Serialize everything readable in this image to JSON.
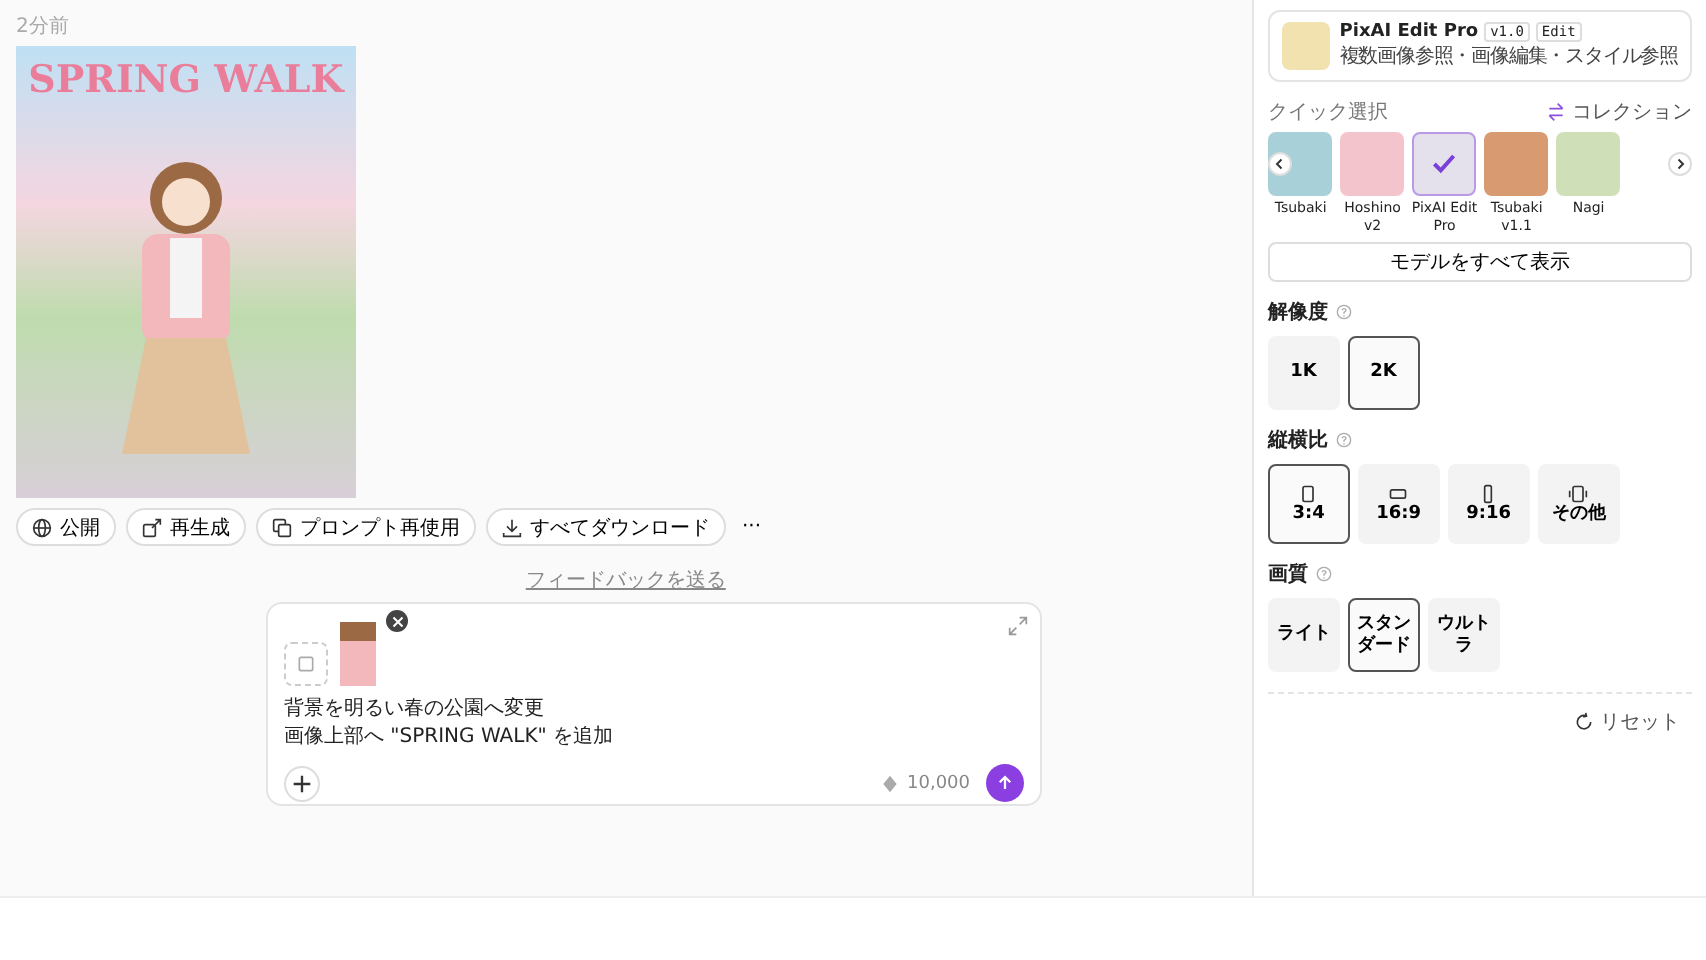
{
  "generation": {
    "time": "2分前",
    "image_title": "SPRING WALK",
    "actions": [
      {
        "kind": "globe",
        "label": "公開"
      },
      {
        "kind": "regen",
        "label": "再生成"
      },
      {
        "kind": "copy",
        "label": "プロンプト再使用"
      },
      {
        "kind": "download",
        "label": "すべてダウンロード"
      },
      {
        "kind": "more",
        "label": "···"
      }
    ]
  },
  "feedback_link": "フィードバックを送る",
  "composer": {
    "prompt_lines": [
      "背景を明るい春の公園へ変更",
      "画像上部へ \"SPRING WALK\" を追加"
    ],
    "credits": "10,000"
  },
  "sidebar": {
    "model": {
      "name": "PixAI Edit Pro",
      "version": "v1.0",
      "tag": "Edit",
      "description": "複数画像参照・画像編集・スタイル参照"
    },
    "quick_select_label": "クイック選択",
    "collection_link": "コレクション",
    "models": [
      {
        "name": "Tsubaki",
        "selected": false,
        "color": "#a8d0d8"
      },
      {
        "name": "Hoshino v2",
        "selected": false,
        "color": "#f3c4cc"
      },
      {
        "name": "PixAI Edit Pro",
        "selected": true,
        "color": "#e4e0ec"
      },
      {
        "name": "Tsubaki v1.1",
        "selected": false,
        "color": "#d89a70"
      },
      {
        "name": "Nagi",
        "selected": false,
        "color": "#cfe0b8"
      }
    ],
    "show_all_button": "モデルをすべて表示",
    "sections": [
      {
        "title": "解像度",
        "options": [
          {
            "label": "1K",
            "selected": false
          },
          {
            "label": "2K",
            "selected": true
          }
        ]
      },
      {
        "title": "縦横比",
        "options": [
          {
            "label": "3:4",
            "kind": "portrait",
            "selected": true
          },
          {
            "label": "16:9",
            "kind": "landscape",
            "selected": false
          },
          {
            "label": "9:16",
            "kind": "tall",
            "selected": false
          },
          {
            "label": "その他",
            "kind": "custom",
            "selected": false
          }
        ]
      },
      {
        "title": "画質",
        "options": [
          {
            "label": "ライト",
            "selected": false
          },
          {
            "label": "スタンダード",
            "selected": true
          },
          {
            "label": "ウルトラ",
            "selected": false
          }
        ]
      }
    ],
    "reset_button": "リセット"
  }
}
